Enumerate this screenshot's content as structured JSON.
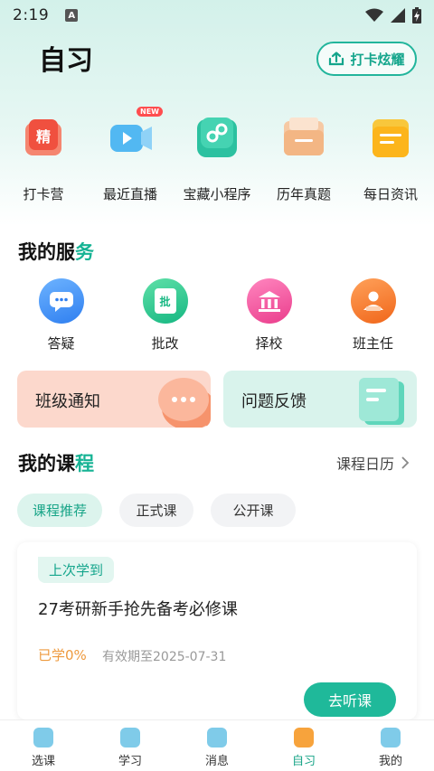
{
  "status_bar": {
    "time": "2:19",
    "indicator": "A"
  },
  "header": {
    "title": "自习",
    "checkin_label": "打卡炫耀"
  },
  "quick_items": [
    {
      "label": "打卡营",
      "glyph": "精",
      "icon": "camp-icon"
    },
    {
      "label": "最近直播",
      "badge": "NEW",
      "icon": "live-video-icon"
    },
    {
      "label": "宝藏小程序",
      "icon": "mini-program-icon"
    },
    {
      "label": "历年真题",
      "icon": "exam-folder-icon"
    },
    {
      "label": "每日资讯",
      "icon": "news-icon"
    }
  ],
  "services": {
    "title_main": "我的服",
    "title_accent": "务",
    "items": [
      {
        "label": "答疑",
        "icon": "chat-bubble-icon",
        "color": "#3a8cf3"
      },
      {
        "label": "批改",
        "glyph": "批",
        "icon": "grading-icon",
        "color": "#22c08a"
      },
      {
        "label": "择校",
        "icon": "school-building-icon",
        "color": "#f04d9a"
      },
      {
        "label": "班主任",
        "icon": "teacher-icon",
        "color": "#f6781f"
      }
    ],
    "cards": {
      "notice": "班级通知",
      "feedback": "问题反馈"
    }
  },
  "courses": {
    "title_main": "我的课",
    "title_accent": "程",
    "calendar_link": "课程日历",
    "tabs": [
      "课程推荐",
      "正式课",
      "公开课"
    ],
    "active_tab": 0,
    "card": {
      "badge": "上次学到",
      "title": "27考研新手抢先备考必修课",
      "progress": "已学0%",
      "expire": "有效期至2025-07-31",
      "action": "去听课"
    }
  },
  "bottom_nav": [
    {
      "label": "选课"
    },
    {
      "label": "学习"
    },
    {
      "label": "消息"
    },
    {
      "label": "自习",
      "active": true
    },
    {
      "label": "我的"
    }
  ],
  "colors": {
    "accent": "#16b394",
    "progress": "#ee9a3e"
  }
}
